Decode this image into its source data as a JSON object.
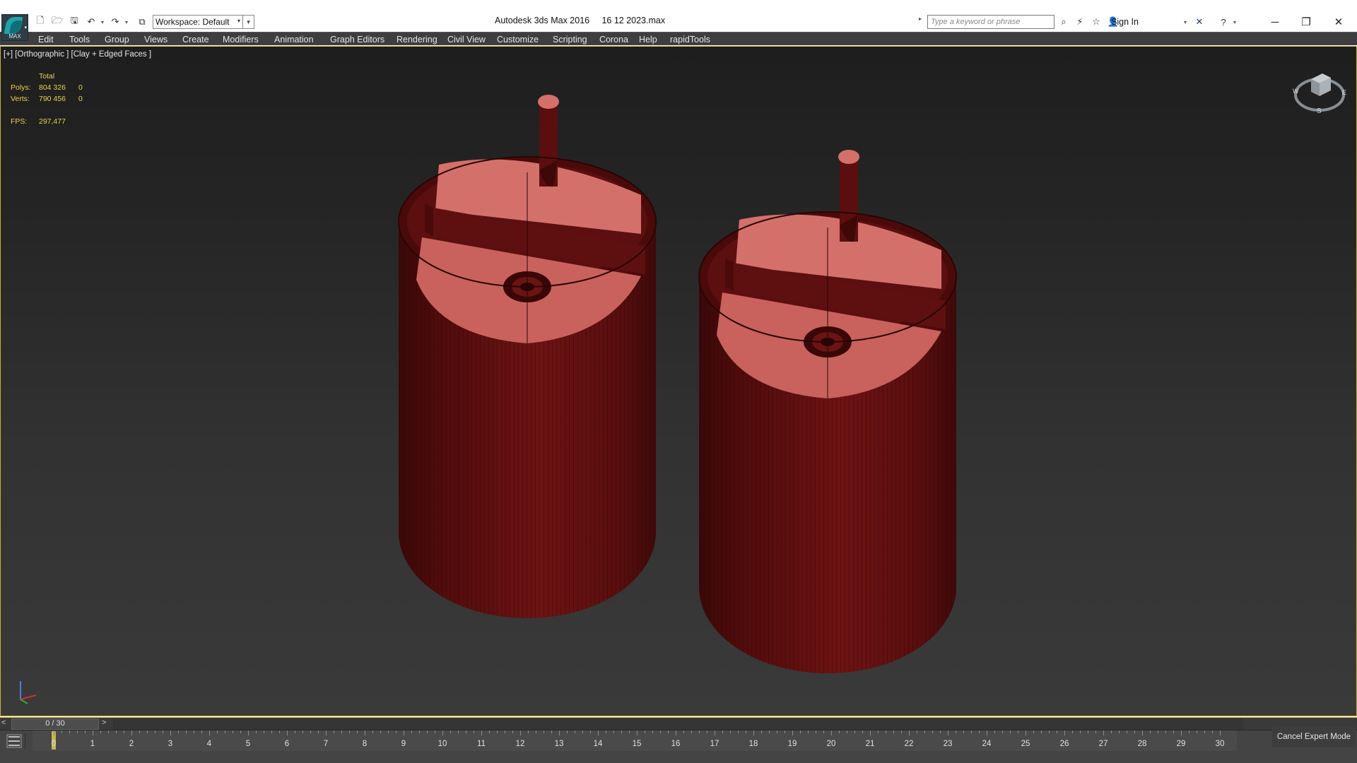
{
  "app": {
    "logo_text": "MAX",
    "window_title": "Autodesk 3ds Max 2016     16 12 2023.max"
  },
  "toolbar": {
    "workspace_value": "Workspace: Default",
    "search_placeholder": "Type a keyword or phrase",
    "signin_label": "Sign In"
  },
  "menu": {
    "items": [
      "Edit",
      "Tools",
      "Group",
      "Views",
      "Create",
      "Modifiers",
      "Animation",
      "Graph Editors",
      "Rendering",
      "Civil View",
      "Customize",
      "Scripting",
      "Corona",
      "Help",
      "rapidTools"
    ]
  },
  "viewport": {
    "label": "[+] [Orthographic ] [Clay + Edged Faces ]",
    "stats": {
      "total_header": "Total",
      "polys_label": "Polys:",
      "polys_total": "804 326",
      "polys_selected": "0",
      "verts_label": "Verts:",
      "verts_total": "790 456",
      "verts_selected": "0",
      "fps_label": "FPS:",
      "fps_value": "297,477"
    },
    "object_color": "#6b1212",
    "accent_border": "#c9b43a"
  },
  "timeline": {
    "slider_prev": "<",
    "slider_text": "0 / 30",
    "slider_next": ">",
    "frames": [
      "0",
      "1",
      "2",
      "3",
      "4",
      "5",
      "6",
      "7",
      "8",
      "9",
      "10",
      "11",
      "12",
      "13",
      "14",
      "15",
      "16",
      "17",
      "18",
      "19",
      "20",
      "21",
      "22",
      "23",
      "24",
      "25",
      "26",
      "27",
      "28",
      "29",
      "30"
    ]
  },
  "status": {
    "cancel_expert": "Cancel Expert Mode"
  }
}
